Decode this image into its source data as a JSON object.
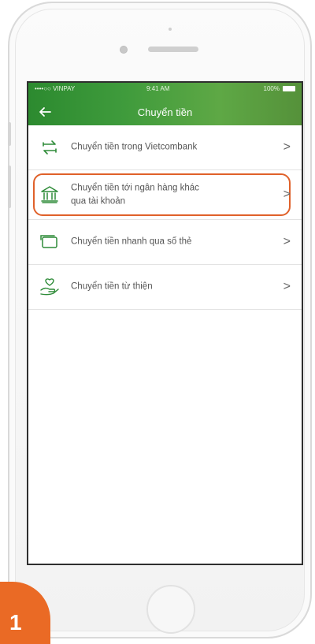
{
  "status_bar": {
    "carrier": "••••○○ VINPAY  ",
    "time": "9:41 AM",
    "battery": "100%"
  },
  "header": {
    "title": "Chuyển tiền"
  },
  "menu": [
    {
      "label": "Chuyển tiền trong Vietcombank",
      "icon": "transfer-arrows-icon"
    },
    {
      "label_line1": "Chuyển tiền tới ngân hàng khác",
      "label_line2": "qua tài khoản",
      "icon": "bank-icon",
      "highlighted": true
    },
    {
      "label": "Chuyển tiền nhanh qua số thẻ",
      "icon": "card-icon"
    },
    {
      "label": "Chuyển tiền từ thiện",
      "icon": "charity-hand-icon"
    }
  ],
  "chevron": ">",
  "step_badge": "1",
  "colors": {
    "header_green": "#3f9b3c",
    "icon_green": "#2e8b38",
    "highlight_orange": "#e0612a",
    "badge_orange": "#ea6a25"
  }
}
